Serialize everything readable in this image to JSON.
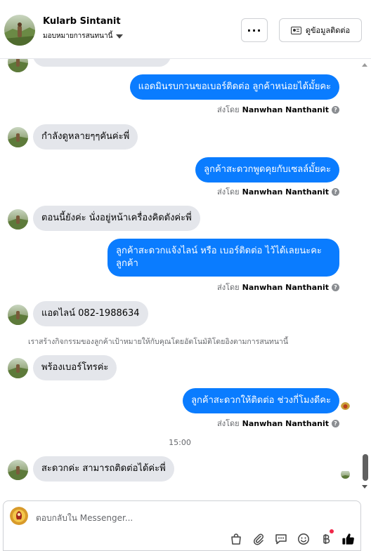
{
  "header": {
    "contact_name": "Kularb Sintanit",
    "assign_label": "มอบหมายการสนทนานี้",
    "more_label": "···",
    "contact_info_label": "ดูข้อมูลติดต่อ"
  },
  "messages": {
    "m1": "แอดมินรบกวนขอเบอร์ติดต่อ ลูกค้าหน่อยได้มั้ยคะ",
    "m2": "กำลังดูหลายๆๆคันค่ะพี่",
    "m3": "ลูกค้าสะดวกพูดคุยกับเซลล์มั้ยคะ",
    "m4": "ตอนนี้ยังค่ะ นั่งอยู่หน้าเครื่องคิดตังค่ะพี่",
    "m5_line1": "ลูกค้าสะดวกแจ้งไลน์ หรือ เบอร์ติดต่อ ไว้ได้เลยนะคะ",
    "m5_line2": "ลูกค้า",
    "m6": "แอดไลน์ 082-1988634",
    "m7": "พร้องเบอร์โทรค่ะ",
    "m8": "ลูกค้าสะดวกให้ติดต่อ ช่วงกี่โมงดีคะ",
    "m9": "สะดวกค่ะ สามารถติดต่อได้ค่ะพี่"
  },
  "sent_by": {
    "prefix": "ส่งโดย",
    "agent": "Nanwhan Nanthanit",
    "info_glyph": "?"
  },
  "system_note": "เราสร้างกิจกรรมของลูกค้าเป้าหมายให้กับคุณโดยอัตโนมัติโดยอิงตามการสนทนานี้",
  "timestamp": "15:00",
  "composer": {
    "placeholder": "ตอบกลับใน Messenger..."
  },
  "icons": {
    "toolbar": [
      "shopping-bag-icon",
      "paperclip-icon",
      "saved-reply-icon",
      "emoji-icon",
      "baht-icon",
      "thumbs-up-icon"
    ]
  },
  "colors": {
    "outgoing_bubble": "#0a7cff",
    "incoming_bubble": "#e4e6eb",
    "secondary_text": "#65676b",
    "like_button": "#050505",
    "notification_dot": "#f02849"
  }
}
